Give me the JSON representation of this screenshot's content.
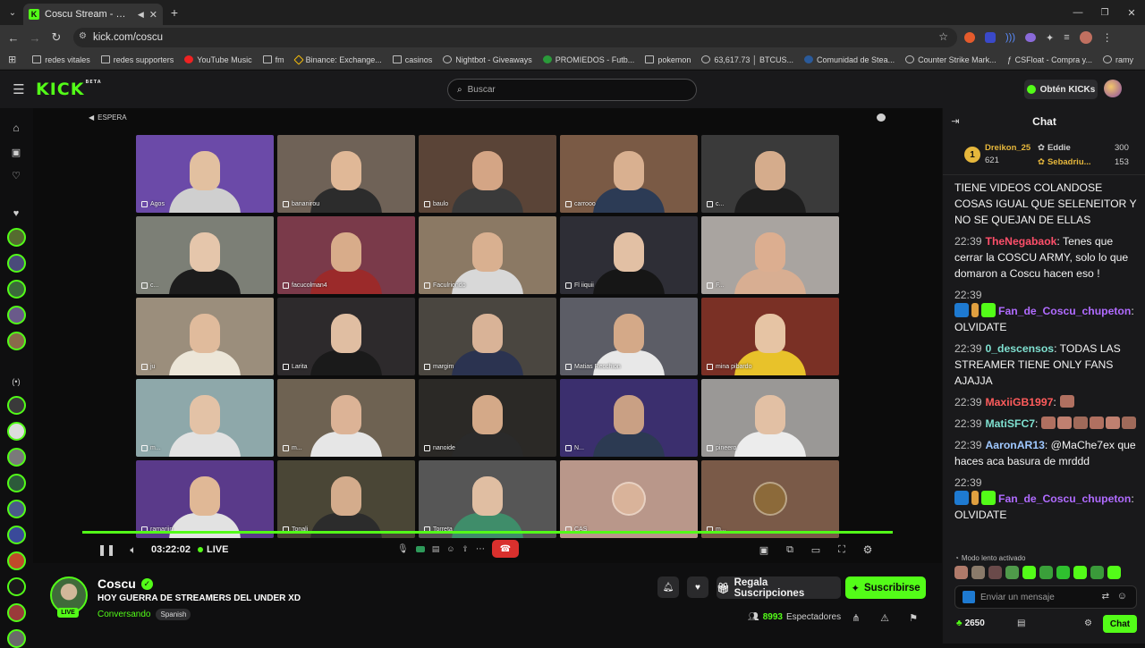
{
  "browser": {
    "tab_title": "Coscu Stream - Watch Live",
    "url": "kick.com/coscu",
    "bookmarks": [
      {
        "label": "redes vitales",
        "icon": "folder-icon"
      },
      {
        "label": "redes supporters",
        "icon": "folder-icon"
      },
      {
        "label": "YouTube Music",
        "icon": "youtube-music-icon"
      },
      {
        "label": "fm",
        "icon": "folder-icon"
      },
      {
        "label": "Binance: Exchange...",
        "icon": "binance-icon"
      },
      {
        "label": "casinos",
        "icon": "folder-icon"
      },
      {
        "label": "Nightbot - Giveaways",
        "icon": "nightbot-icon"
      },
      {
        "label": "PROMIEDOS - Futb...",
        "icon": "promiedos-icon"
      },
      {
        "label": "pokemon",
        "icon": "folder-icon"
      },
      {
        "label": "63,617.73 │ BTCUS...",
        "icon": "tradingview-icon"
      },
      {
        "label": "Comunidad de Stea...",
        "icon": "steam-icon"
      },
      {
        "label": "Counter Strike Mark...",
        "icon": "csmarket-icon"
      },
      {
        "label": "CSFloat - Compra y...",
        "icon": "csfloat-icon"
      },
      {
        "label": "ramy",
        "icon": "globe-icon"
      }
    ]
  },
  "header": {
    "logo": "KICK",
    "logo_sup": "BETA",
    "search_placeholder": "Buscar",
    "get_kicks_label": "Obtén KICKs"
  },
  "player": {
    "espera_label": "ESPERA",
    "time": "03:22:02",
    "live_label": "LIVE",
    "progress": 1.0,
    "participants": [
      {
        "name": "Agos",
        "bg": "#6b4aa8",
        "skin": "#e2c0a0",
        "shirt": "#cfcfcf"
      },
      {
        "name": "bananirou",
        "bg": "#6f6257",
        "skin": "#e0b897",
        "shirt": "#2c2c2c"
      },
      {
        "name": "baulo",
        "bg": "#5a4437",
        "skin": "#d4a585",
        "shirt": "#3a3a3a"
      },
      {
        "name": "carrooo",
        "bg": "#7a5a45",
        "skin": "#d9b090",
        "shirt": "#2c3b55"
      },
      {
        "name": "c...",
        "bg": "#3a3a3a",
        "skin": "#d5ac8c",
        "shirt": "#1e1e1e"
      },
      {
        "name": "c...",
        "bg": "#7c7f76",
        "skin": "#e5c6ab",
        "shirt": "#1c1c1c"
      },
      {
        "name": "facucolman4",
        "bg": "#7a3a4a",
        "skin": "#d8ac8a",
        "shirt": "#9b2a2a"
      },
      {
        "name": "Faculriondo",
        "bg": "#8b7964",
        "skin": "#d9b090",
        "shirt": "#d8d8d8"
      },
      {
        "name": "Fl iiquii",
        "bg": "#2e2e36",
        "skin": "#e2c0a4",
        "shirt": "#161616"
      },
      {
        "name": "F...",
        "bg": "#a9a4a0",
        "skin": "#dcae90",
        "shirt": "#d8ae92"
      },
      {
        "name": "ju",
        "bg": "#9b8e7c",
        "skin": "#e0bb9c",
        "shirt": "#ece6d8"
      },
      {
        "name": "Larita",
        "bg": "#2d2a2c",
        "skin": "#e0bea2",
        "shirt": "#1a1a1a"
      },
      {
        "name": "margim",
        "bg": "#4a4640",
        "skin": "#d9b397",
        "shirt": "#2b3350"
      },
      {
        "name": "Matias Recchion",
        "bg": "#5c5d66",
        "skin": "#d4a988",
        "shirt": "#e8e8e8"
      },
      {
        "name": "mina pibardo",
        "bg": "#7a3025",
        "skin": "#e6c4a4",
        "shirt": "#e8c22a"
      },
      {
        "name": "m...",
        "bg": "#8ea8aa",
        "skin": "#e3c2a6",
        "shirt": "#e2e2e2"
      },
      {
        "name": "m...",
        "bg": "#6e6252",
        "skin": "#dcb396",
        "shirt": "#e6e6e6"
      },
      {
        "name": "nanoide",
        "bg": "#2b2926",
        "skin": "#d4a988",
        "shirt": "#2a2a2a"
      },
      {
        "name": "N...",
        "bg": "#3b2f6e",
        "skin": "#c9a084",
        "shirt": "#2c3a52"
      },
      {
        "name": "pineero",
        "bg": "#9a9896",
        "skin": "#e2c0a4",
        "shirt": "#ececec"
      },
      {
        "name": "ramariin",
        "bg": "#5a3a8a",
        "skin": "#e0b896",
        "shirt": "#e2e2e2"
      },
      {
        "name": "Tonali",
        "bg": "#4a4636",
        "skin": "#d4ac8c",
        "shirt": "#2c2c2c"
      },
      {
        "name": "Torreta",
        "bg": "#565656",
        "skin": "#e0bea2",
        "shirt": "#3f8d6a"
      },
      {
        "name": "CAS",
        "bg": "#b9978a",
        "skin": "#d9b39a",
        "shirt": "#b9978a",
        "avatar": true
      },
      {
        "name": "m...",
        "bg": "#7a5a48",
        "skin": "#8c6a3a",
        "shirt": "#7a5a48",
        "avatar": true
      }
    ]
  },
  "stream": {
    "live_chip": "LIVE",
    "channel": "Coscu",
    "title": "HOY GUERRA DE STREAMERS DEL UNDER XD",
    "category": "Conversando",
    "language": "Spanish",
    "gift_label": "Regala Suscripciones",
    "subscribe_label": "Suscribirse",
    "viewers_count": "8993",
    "viewers_label": "Espectadores"
  },
  "chat": {
    "title": "Chat",
    "leaderboard": [
      {
        "rank": "1",
        "name": "Dreikon_25",
        "score": "621",
        "color": "#e6b73c"
      },
      {
        "name": "Eddie",
        "score": "300",
        "color": "#cfcfcf"
      },
      {
        "name": "Sebadriu...",
        "score": "153",
        "color": "#e6b73c"
      }
    ],
    "messages": [
      {
        "time": "",
        "user": "",
        "text": "TIENE VIDEOS COLANDOSE COSAS IGUAL QUE SELENEITOR Y NO SE QUEJAN DE ELLAS",
        "color": "#ffffff"
      },
      {
        "time": "22:39",
        "user": "TheNegabaok",
        "text": ": Tenes que cerrar la COSCU ARMY, solo lo que domaron a Coscu hacen eso !",
        "color": "#ff4f6a"
      },
      {
        "time": "22:39",
        "user": "Fan_de_Coscu_chupeton",
        "text": ": OLVIDATE",
        "color": "#b06bff",
        "badges": true
      },
      {
        "time": "22:39",
        "user": "0_descensos",
        "text": ": TODAS LAS STREAMER TIENE ONLY FANS AJAJJA",
        "color": "#7fe0d0"
      },
      {
        "time": "22:39",
        "user": "MaxiiGB1997",
        "text": ":",
        "color": "#ff5c5c",
        "emotes": 1
      },
      {
        "time": "22:39",
        "user": "MatiSFC7",
        "text": ":",
        "color": "#7fe0d0",
        "emotes": 6
      },
      {
        "time": "22:39",
        "user": "AaronAR13",
        "text": ": @MaChe7ex que haces aca basura de mrddd",
        "color": "#9fc8ff"
      },
      {
        "time": "22:39",
        "user": "Fan_de_Coscu_chupeton",
        "text": ": OLVIDATE",
        "color": "#b06bff",
        "badges": true
      }
    ],
    "slow_mode_label": "Modo lento activado",
    "input_placeholder": "Enviar un mensaje",
    "kicks_balance": "2650",
    "send_label": "Chat"
  },
  "colors": {
    "brand": "#53fc18",
    "background": "#0f0f10",
    "panel": "#19191b"
  }
}
